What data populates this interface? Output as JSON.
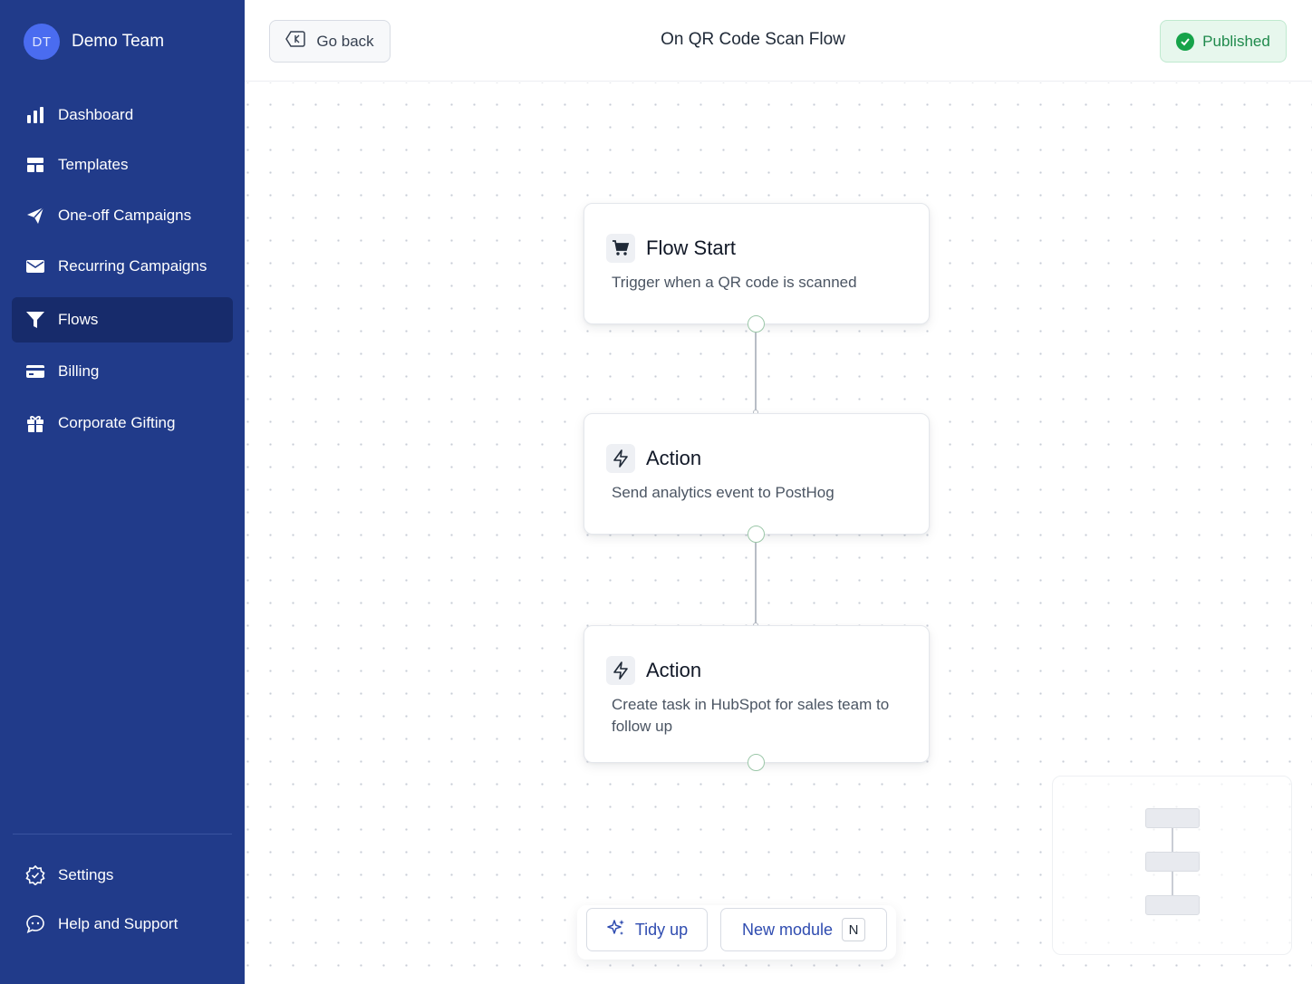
{
  "team": {
    "initials": "DT",
    "name": "Demo Team"
  },
  "sidebar": {
    "items": [
      {
        "label": "Dashboard",
        "icon": "bar-chart-icon"
      },
      {
        "label": "Templates",
        "icon": "layout-icon"
      },
      {
        "label": "One-off Campaigns",
        "icon": "paper-plane-icon"
      },
      {
        "label": "Recurring Campaigns",
        "icon": "envelope-icon"
      },
      {
        "label": "Flows",
        "icon": "funnel-icon",
        "active": true
      },
      {
        "label": "Billing",
        "icon": "credit-card-icon"
      },
      {
        "label": "Corporate Gifting",
        "icon": "gift-icon"
      }
    ],
    "footer": [
      {
        "label": "Settings",
        "icon": "gear-badge-icon"
      },
      {
        "label": "Help and Support",
        "icon": "chat-bubble-icon"
      }
    ]
  },
  "header": {
    "back_label": "Go back",
    "title": "On QR Code Scan Flow",
    "status": "Published"
  },
  "flow": {
    "nodes": [
      {
        "title": "Flow Start",
        "description": "Trigger when a QR code is scanned",
        "icon": "cart-icon"
      },
      {
        "title": "Action",
        "description": "Send analytics event to PostHog",
        "icon": "lightning-icon"
      },
      {
        "title": "Action",
        "description": "Create task  in HubSpot for sales team to follow up",
        "icon": "lightning-icon"
      }
    ]
  },
  "toolbar": {
    "tidy_label": "Tidy up",
    "new_module_label": "New module",
    "new_module_shortcut": "N"
  },
  "colors": {
    "sidebar_bg": "#213b8a",
    "sidebar_active": "#172b6b",
    "accent": "#2f4cb0",
    "published_green": "#16a34a"
  }
}
